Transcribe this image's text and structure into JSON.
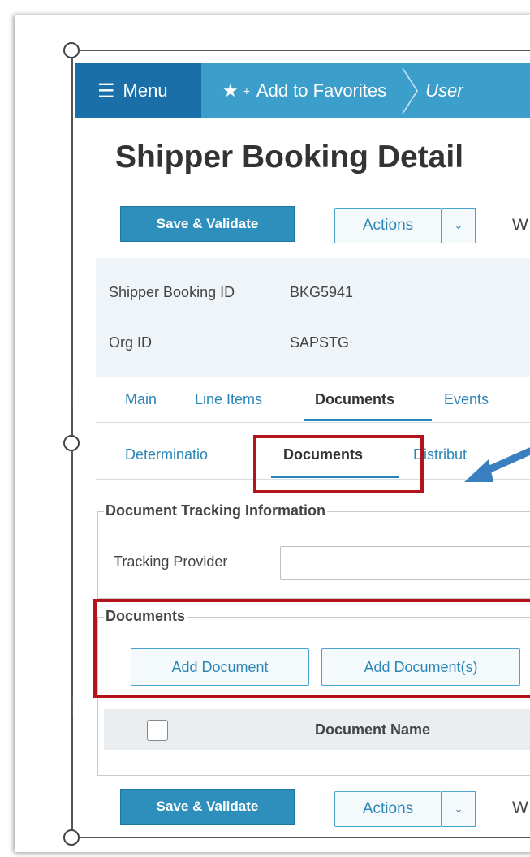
{
  "toolbar": {
    "menu_label": "Menu",
    "favorites_label": "Add to Favorites",
    "breadcrumb": "User"
  },
  "page": {
    "title": "Shipper Booking Detail"
  },
  "actions_top": {
    "save_label": "Save & Validate",
    "actions_label": "Actions",
    "extra_label": "W"
  },
  "info": {
    "booking_id_label": "Shipper Booking ID",
    "booking_id_value": "BKG5941",
    "org_id_label": "Org ID",
    "org_id_value": "SAPSTG"
  },
  "main_tabs": [
    {
      "label": "Main"
    },
    {
      "label": "Line Items"
    },
    {
      "label": "Documents"
    },
    {
      "label": "Events"
    }
  ],
  "sub_tabs": [
    {
      "label": "Determinatio"
    },
    {
      "label": "Documents"
    },
    {
      "label": "Distribut"
    }
  ],
  "tracking": {
    "legend": "Document Tracking Information",
    "provider_label": "Tracking Provider",
    "provider_value": ""
  },
  "documents": {
    "legend": "Documents",
    "add_document_label": "Add Document",
    "add_documents_label": "Add Document(s)",
    "column_name": "Document Name"
  },
  "actions_bottom": {
    "save_label": "Save & Validate",
    "actions_label": "Actions",
    "extra_label": "W"
  },
  "colors": {
    "toolbar": "#3b9ecb",
    "menu": "#1a6fa8",
    "primary_button": "#2e8fbd",
    "highlight": "#b3141b",
    "arrow": "#3a7fc0"
  }
}
